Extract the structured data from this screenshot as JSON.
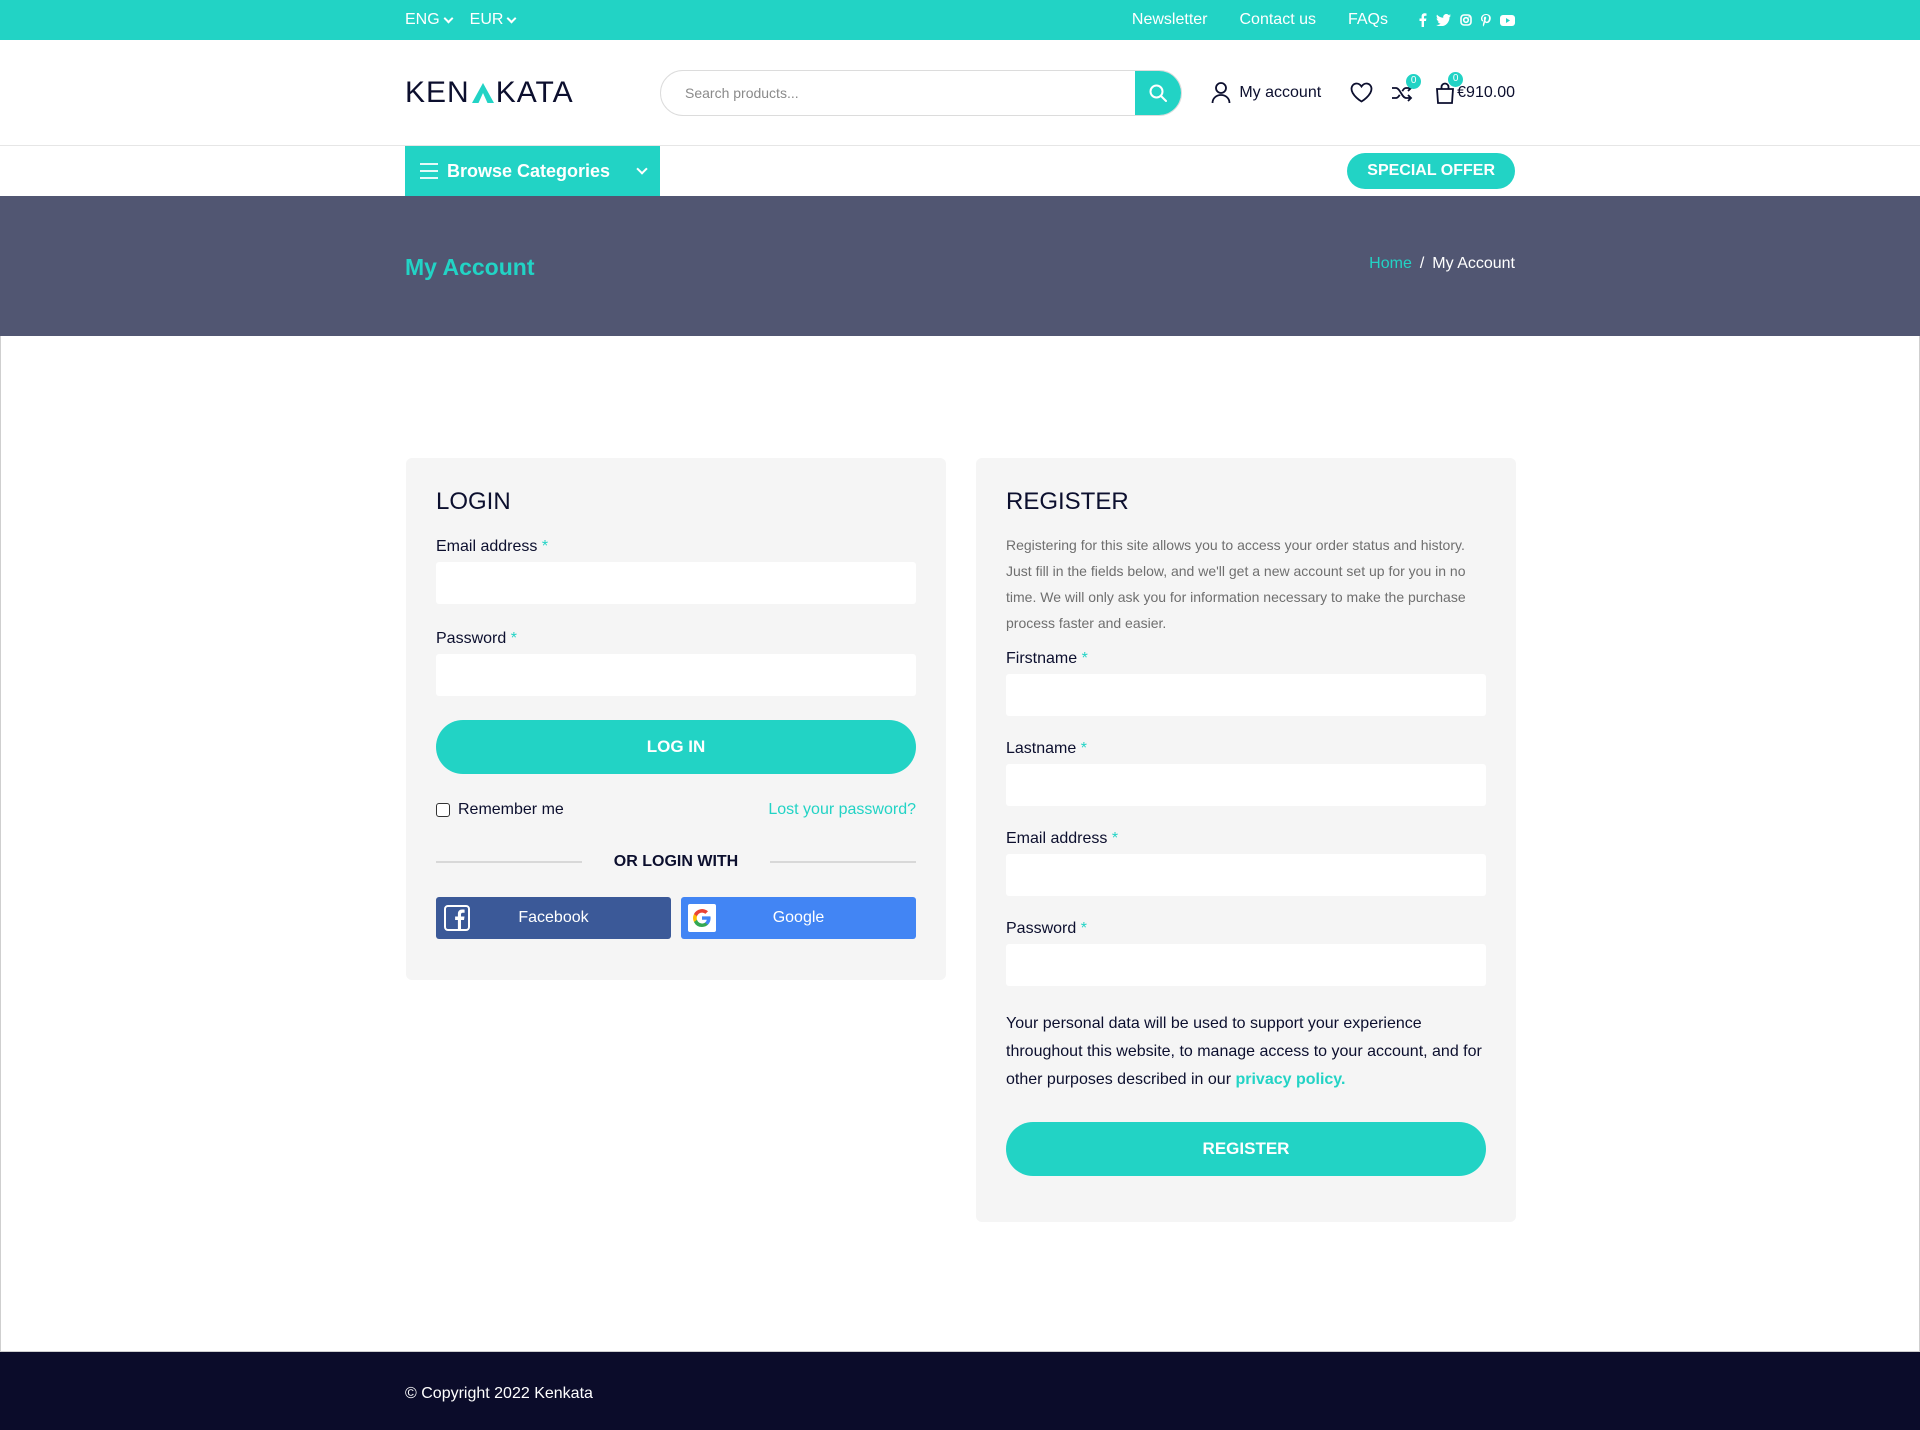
{
  "topbar": {
    "language": "ENG",
    "currency": "EUR",
    "links": [
      "Newsletter",
      "Contact us",
      "FAQs"
    ],
    "social_icons": [
      "facebook-icon",
      "twitter-icon",
      "instagram-icon",
      "pinterest-icon",
      "youtube-icon"
    ]
  },
  "header": {
    "logo_left": "KEN",
    "logo_right": "KATA",
    "search_placeholder": "Search products...",
    "account_label": "My account",
    "compare_count": "0",
    "cart_count": "0",
    "cart_total": "€910.00"
  },
  "nav": {
    "browse_label": "Browse Categories",
    "special_offer": "SPECIAL OFFER"
  },
  "banner": {
    "title": "My Account",
    "breadcrumb_home": "Home",
    "breadcrumb_sep": "/",
    "breadcrumb_current": "My Account"
  },
  "login": {
    "title": "LOGIN",
    "email_label": "Email address",
    "password_label": "Password",
    "required_mark": "*",
    "submit": "LOG IN",
    "remember": "Remember me",
    "lost_password": "Lost your password?",
    "or_login_with": "OR LOGIN WITH",
    "facebook": "Facebook",
    "google": "Google"
  },
  "register": {
    "title": "REGISTER",
    "description": "Registering for this site allows you to access your order status and history. Just fill in the fields below, and we'll get a new account set up for you in no time. We will only ask you for information necessary to make the purchase process faster and easier.",
    "firstname_label": "Firstname",
    "lastname_label": "Lastname",
    "email_label": "Email address",
    "password_label": "Password",
    "privacy_text": "Your personal data will be used to support your experience throughout this website, to manage access to your account, and for other purposes described in our ",
    "privacy_link": "privacy policy.",
    "submit": "REGISTER"
  },
  "footer": {
    "copyright": "© Copyright 2022 Kenkata"
  },
  "colors": {
    "accent": "#22d3c5",
    "banner": "#515672",
    "footer": "#0b0c2a",
    "facebook": "#3b5998",
    "google": "#4285f4"
  }
}
